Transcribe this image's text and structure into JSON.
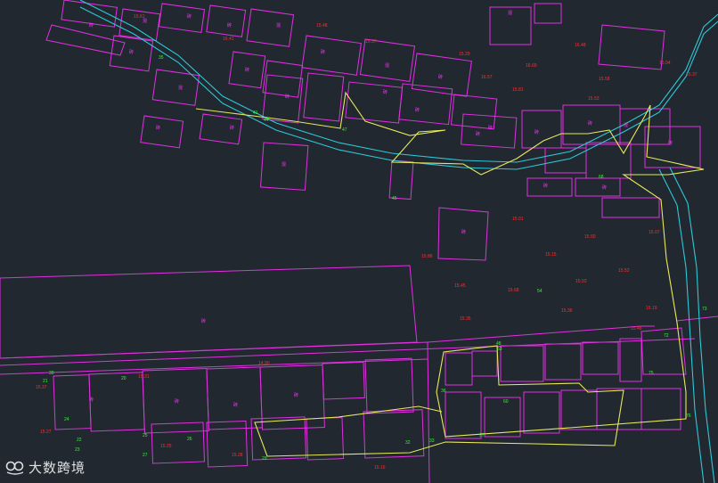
{
  "app": {
    "view": "cad-topographic-drawing"
  },
  "colors": {
    "background": "#212830",
    "parcel": "#e030e0",
    "river": "#2ec8d8",
    "route": "#e8e85a",
    "elevation": "#ff2f2f",
    "point": "#2cff2c"
  },
  "watermark": {
    "text": "大数跨境",
    "icon": "brand-logo-icon"
  },
  "elevations": [
    "15.61",
    "16.41",
    "15.48",
    "15.37",
    "15.29",
    "16.57",
    "15.81",
    "16.48",
    "16.69",
    "15.58",
    "16.04",
    "15.37",
    "15.53",
    "15.01",
    "15.50",
    "15.07",
    "15.15",
    "15.86",
    "15.52",
    "15.45",
    "15.68",
    "15.03",
    "15.19",
    "15.36",
    "15.35",
    "15.48",
    "14.90",
    "15.31",
    "15.37",
    "15.27",
    "15.25",
    "15.28",
    "15.16"
  ],
  "points": [
    "30",
    "35",
    "41",
    "44",
    "45",
    "47",
    "48",
    "53",
    "54",
    "57",
    "60",
    "68",
    "72",
    "73",
    "75",
    "76",
    "20",
    "21",
    "22",
    "23",
    "24",
    "25",
    "26",
    "27",
    "29",
    "32",
    "33",
    "36"
  ],
  "buildings": [
    "砖",
    "混",
    "砖",
    "砖",
    "混",
    "砖",
    "混",
    "砖",
    "砖",
    "砖",
    "砖",
    "砖",
    "混",
    "砖",
    "砖",
    "砖",
    "砖",
    "混",
    "砖",
    "砖",
    "砖",
    "混",
    "砖",
    "砖",
    "砖",
    "混",
    "砖",
    "砖",
    "砖",
    "砖",
    "砖",
    "砖"
  ]
}
